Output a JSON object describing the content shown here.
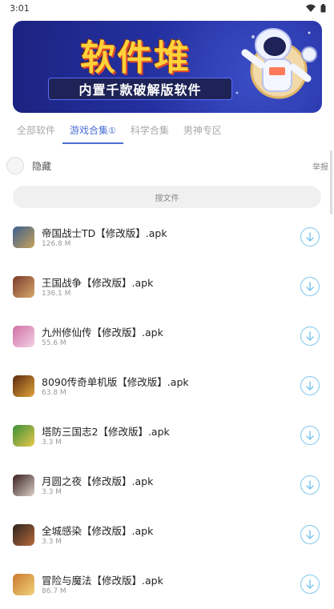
{
  "status": {
    "time": "3:01"
  },
  "banner": {
    "title": "软件堆",
    "subtitle": "内置千款破解版软件"
  },
  "tabs": [
    {
      "label": "全部软件",
      "active": false
    },
    {
      "label": "游戏合集",
      "badge": "①",
      "active": true
    },
    {
      "label": "科学合集",
      "active": false
    },
    {
      "label": "男神专区",
      "active": false
    }
  ],
  "options": {
    "hide_label": "隐藏",
    "report_label": "举报"
  },
  "search": {
    "placeholder": "搜文件"
  },
  "apps": [
    {
      "name": "帝国战士TD【修改版】.apk",
      "size": "126.8 M",
      "icon_colors": [
        "#3a5f8f",
        "#c9a25a"
      ]
    },
    {
      "name": "王国战争【修改版】.apk",
      "size": "136.1 M",
      "icon_colors": [
        "#7a3b2c",
        "#d7a86b"
      ]
    },
    {
      "name": "九州修仙传【修改版】.apk",
      "size": "55.6 M",
      "icon_colors": [
        "#d16fa7",
        "#f2d2e3"
      ]
    },
    {
      "name": "8090传奇单机版【修改版】.apk",
      "size": "63.8 M",
      "icon_colors": [
        "#5a2a0f",
        "#e2a43a"
      ]
    },
    {
      "name": "塔防三国志2【修改版】.apk",
      "size": "3.3 M",
      "icon_colors": [
        "#3b8f3b",
        "#e8c84a"
      ]
    },
    {
      "name": "月圆之夜【修改版】.apk",
      "size": "3.3 M",
      "icon_colors": [
        "#3a1f1f",
        "#d9d0c7"
      ]
    },
    {
      "name": "全城感染【修改版】.apk",
      "size": "3.3 M",
      "icon_colors": [
        "#2b2320",
        "#b86b3c"
      ]
    },
    {
      "name": "冒险与魔法【修改版】.apk",
      "size": "86.7 M",
      "icon_colors": [
        "#c77a2e",
        "#f3d37a"
      ]
    }
  ]
}
